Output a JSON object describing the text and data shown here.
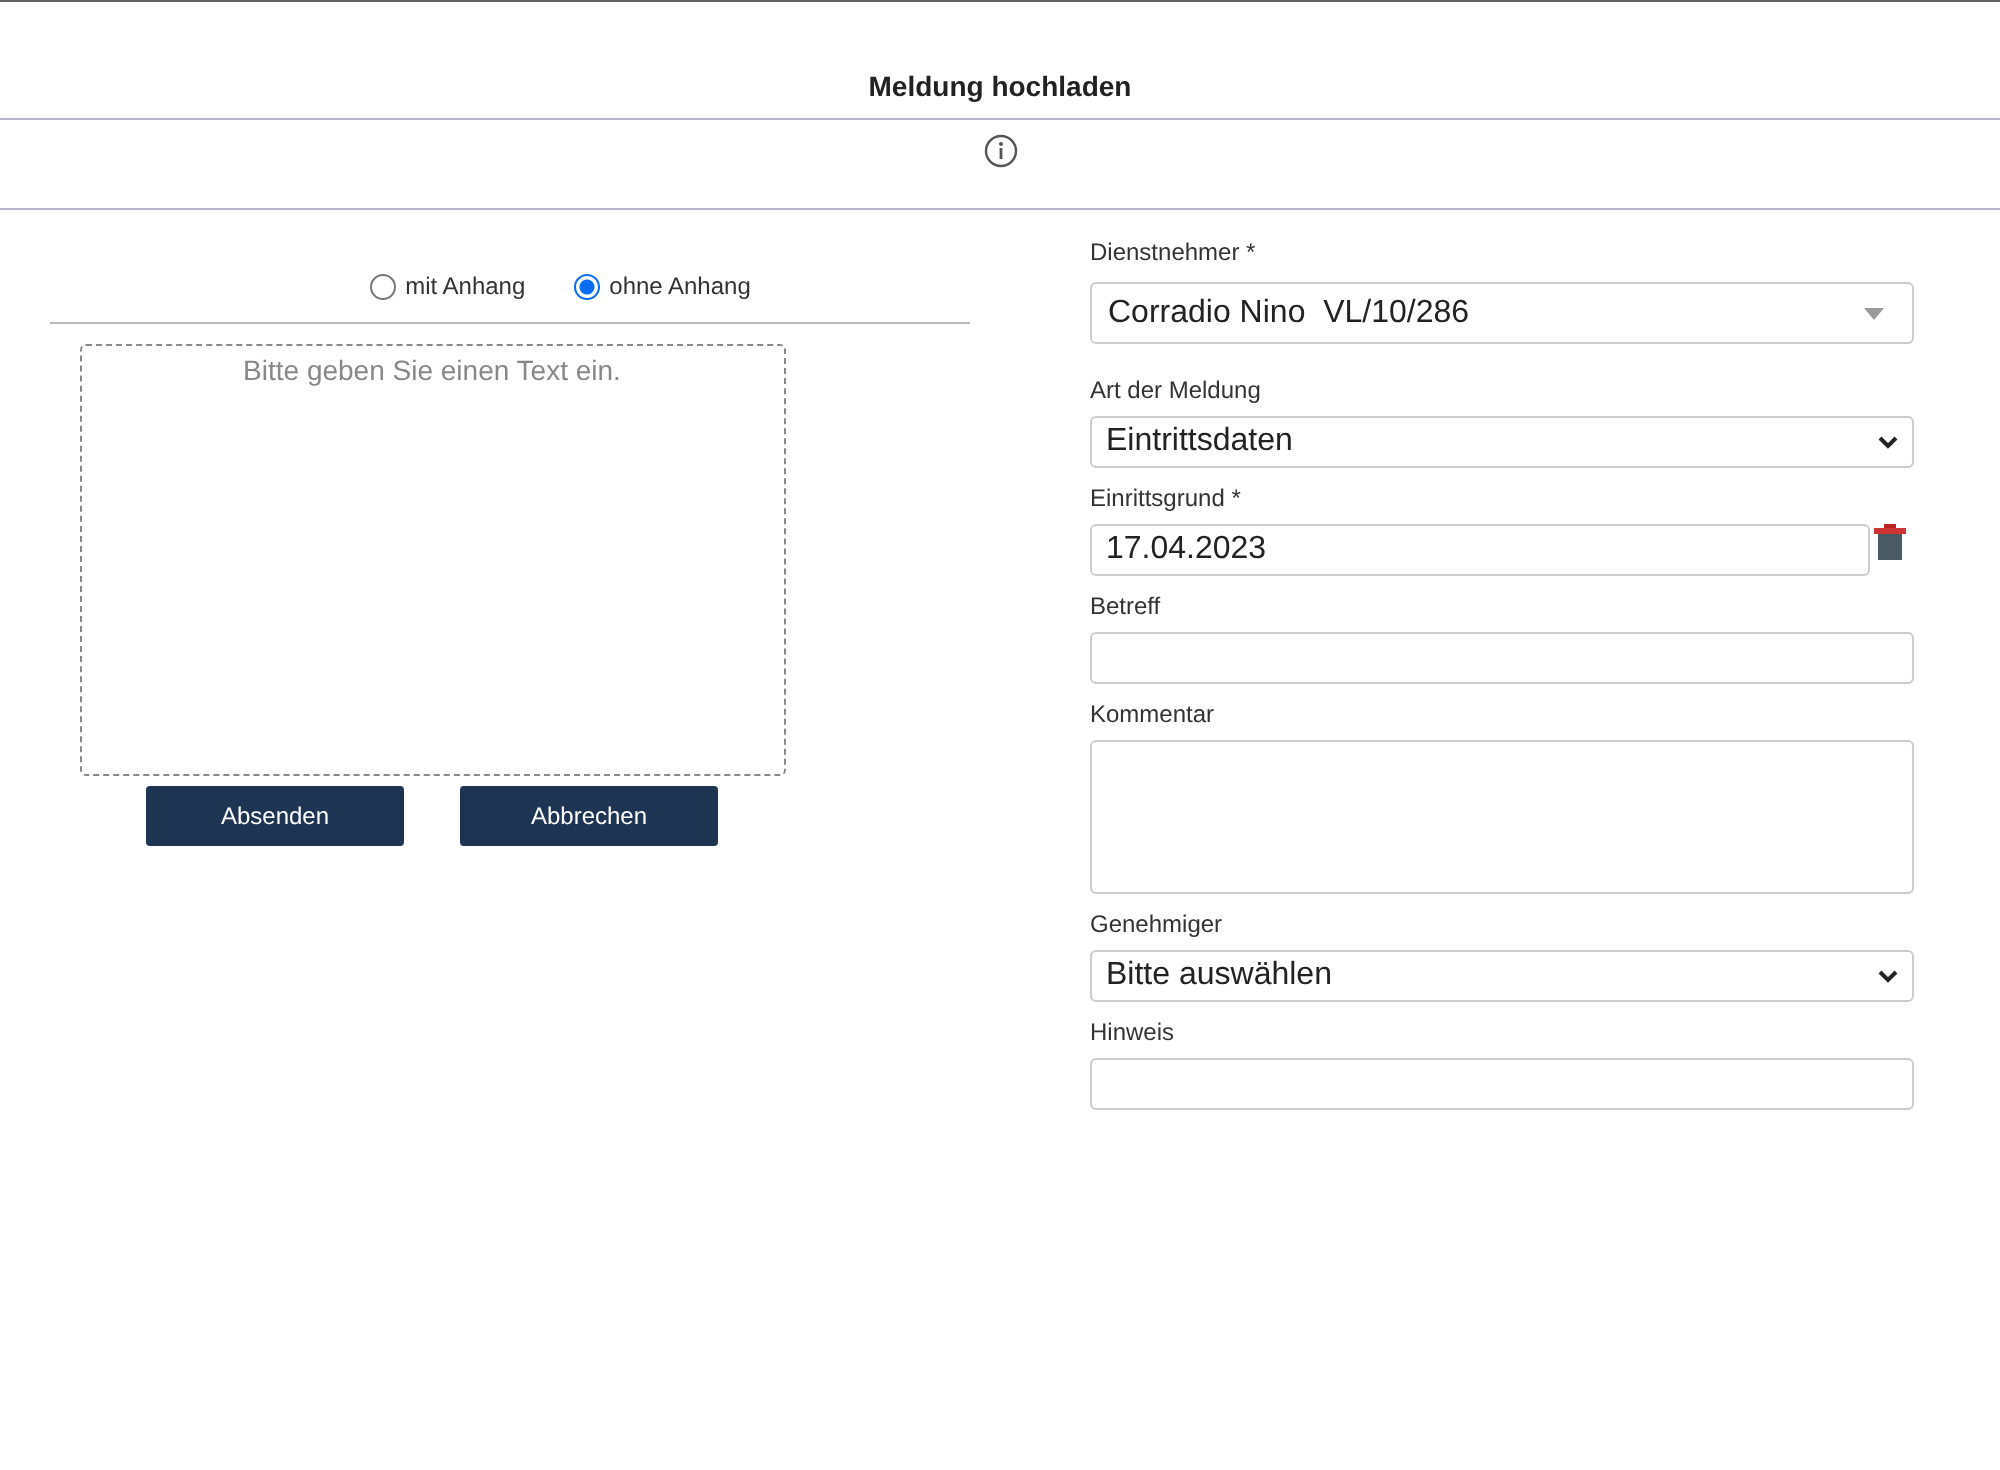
{
  "dialog": {
    "title": "Meldung hochladen"
  },
  "attachment_options": [
    {
      "label": "mit Anhang",
      "selected": false
    },
    {
      "label": "ohne Anhang",
      "selected": true
    }
  ],
  "message_area": {
    "placeholder": "Bitte geben Sie einen Text ein."
  },
  "buttons": [
    "Absenden",
    "Abbrechen"
  ],
  "fields": [
    {
      "kind": "combo",
      "label": "Dienstnehmer *",
      "value": "Corradio Nino  VL/10/286"
    },
    {
      "kind": "select",
      "label": "Art der Meldung",
      "value": "Eintrittsdaten"
    },
    {
      "kind": "date",
      "label": "Einrittsgrund *",
      "value": "17.04.2023"
    },
    {
      "kind": "input",
      "label": "Betreff"
    },
    {
      "kind": "textarea",
      "label": "Kommentar"
    },
    {
      "kind": "select",
      "label": "Genehmiger",
      "value": "Bitte auswählen"
    },
    {
      "kind": "input",
      "label": "Hinweis"
    }
  ]
}
